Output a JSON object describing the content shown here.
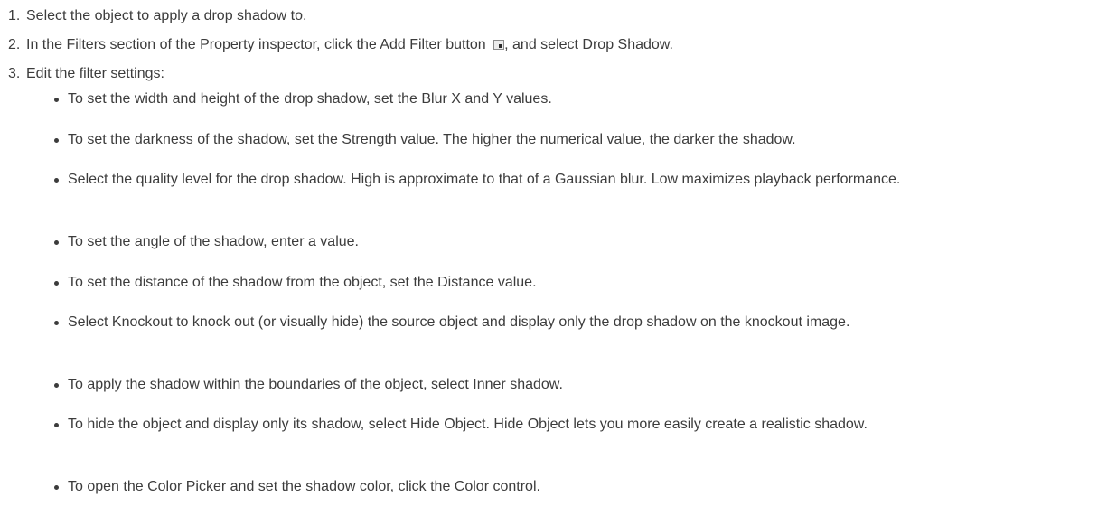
{
  "steps": [
    {
      "num": "1.",
      "text": "Select the object to apply a drop shadow to."
    },
    {
      "num": "2.",
      "text_before": "In the Filters section of the Property inspector, click the Add Filter button ",
      "icon": "add-filter-icon",
      "text_after": ", and select Drop Shadow."
    },
    {
      "num": "3.",
      "text": "Edit the filter settings:"
    }
  ],
  "bullets": [
    "To set the width and height of the drop shadow, set the Blur X and Y values.",
    "To set the darkness of the shadow, set the Strength value. The higher the numerical value, the darker the shadow.",
    "Select the quality level for the drop shadow. High is approximate to that of a Gaussian blur. Low maximizes playback performance.",
    "To set the angle of the shadow, enter a value.",
    "To set the distance of the shadow from the object, set the Distance value.",
    "Select Knockout to knock out (or visually hide) the source object and display only the drop shadow on the knockout image.",
    "To apply the shadow within the boundaries of the object, select Inner shadow.",
    "To hide the object and display only its shadow, select Hide Object. Hide Object lets you more easily create a realistic shadow.",
    "To open the Color Picker and set the shadow color, click the Color control."
  ]
}
